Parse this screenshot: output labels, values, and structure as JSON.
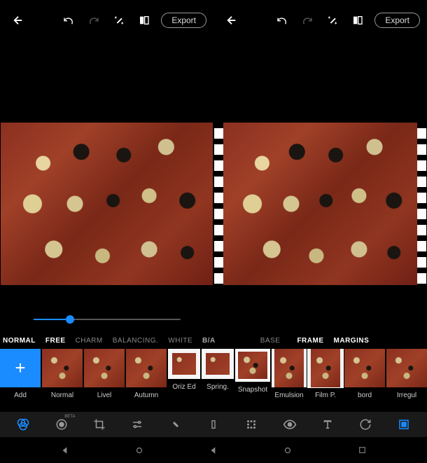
{
  "toolbar": {
    "export_label": "Export"
  },
  "slider": {
    "value": 25
  },
  "categories": [
    {
      "label": "NORMAL",
      "active": true
    },
    {
      "label": "FREE",
      "active": true
    },
    {
      "label": "CHARM",
      "active": false
    },
    {
      "label": "BALANCING.",
      "active": false
    },
    {
      "label": "WHITE",
      "active": false
    },
    {
      "label": "B/A",
      "active": false
    },
    {
      "label": "BASE",
      "active": false
    },
    {
      "label": "FRAME",
      "active": true
    },
    {
      "label": "MARGINS",
      "active": true
    }
  ],
  "presets": {
    "add_label": "Add",
    "items": [
      {
        "label": "Normal",
        "style": "normal"
      },
      {
        "label": "Livel",
        "style": "normal"
      },
      {
        "label": "Autumn",
        "style": "normal"
      },
      {
        "label": "Oriz Ed",
        "style": "white-bg"
      },
      {
        "label": "Spring.",
        "style": "white-bg"
      },
      {
        "label": "Snapshot",
        "style": "snapshot"
      },
      {
        "label": "Emulsion",
        "style": "film"
      },
      {
        "label": "Film P.",
        "style": "film",
        "selected": true
      },
      {
        "label": "bord",
        "style": "normal"
      },
      {
        "label": "Irregul",
        "style": "normal"
      }
    ]
  },
  "tools": {
    "beta_label": "BETA"
  },
  "colors": {
    "accent": "#1a8cff"
  }
}
